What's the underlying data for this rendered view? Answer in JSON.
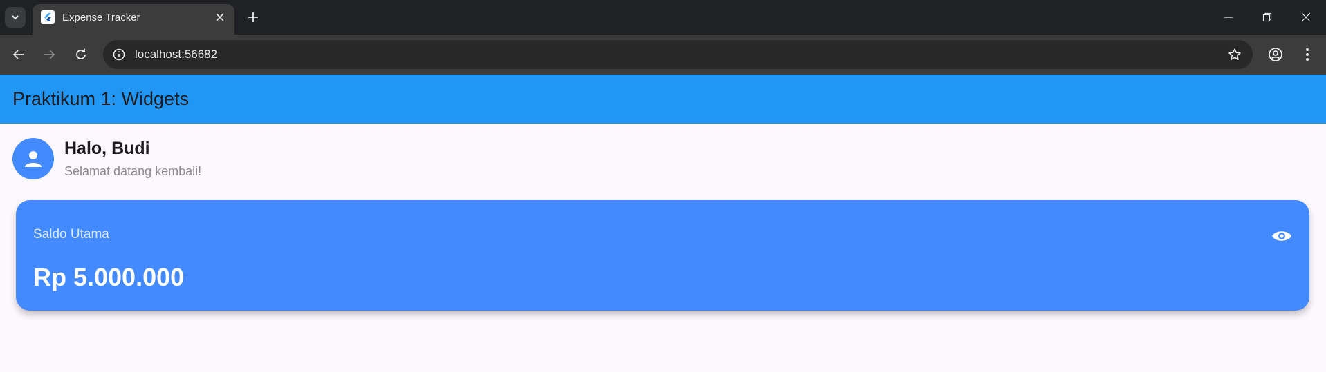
{
  "browser": {
    "tab_title": "Expense Tracker",
    "url": "localhost:56682",
    "icons": {
      "tab_search": "chevron-down-icon",
      "favicon": "flutter-icon",
      "tab_close": "close-icon",
      "new_tab": "plus-icon",
      "back": "arrow-left-icon",
      "forward": "arrow-right-icon",
      "reload": "reload-icon",
      "site_info": "info-icon",
      "bookmark": "star-icon",
      "profile": "account-circle-icon",
      "menu": "more-vert-icon",
      "minimize": "minimize-icon",
      "restore": "restore-icon",
      "close_window": "close-icon"
    }
  },
  "app": {
    "appbar_title": "Praktikum 1: Widgets",
    "greeting": "Halo, Budi",
    "subtitle": "Selamat datang kembali!",
    "balance_card": {
      "label": "Saldo Utama",
      "amount": "Rp 5.000.000",
      "visibility_icon": "eye-icon"
    },
    "colors": {
      "appbar": "#2196f3",
      "card": "#448aff",
      "avatar": "#448aff",
      "background": "#fdf7fe"
    }
  }
}
